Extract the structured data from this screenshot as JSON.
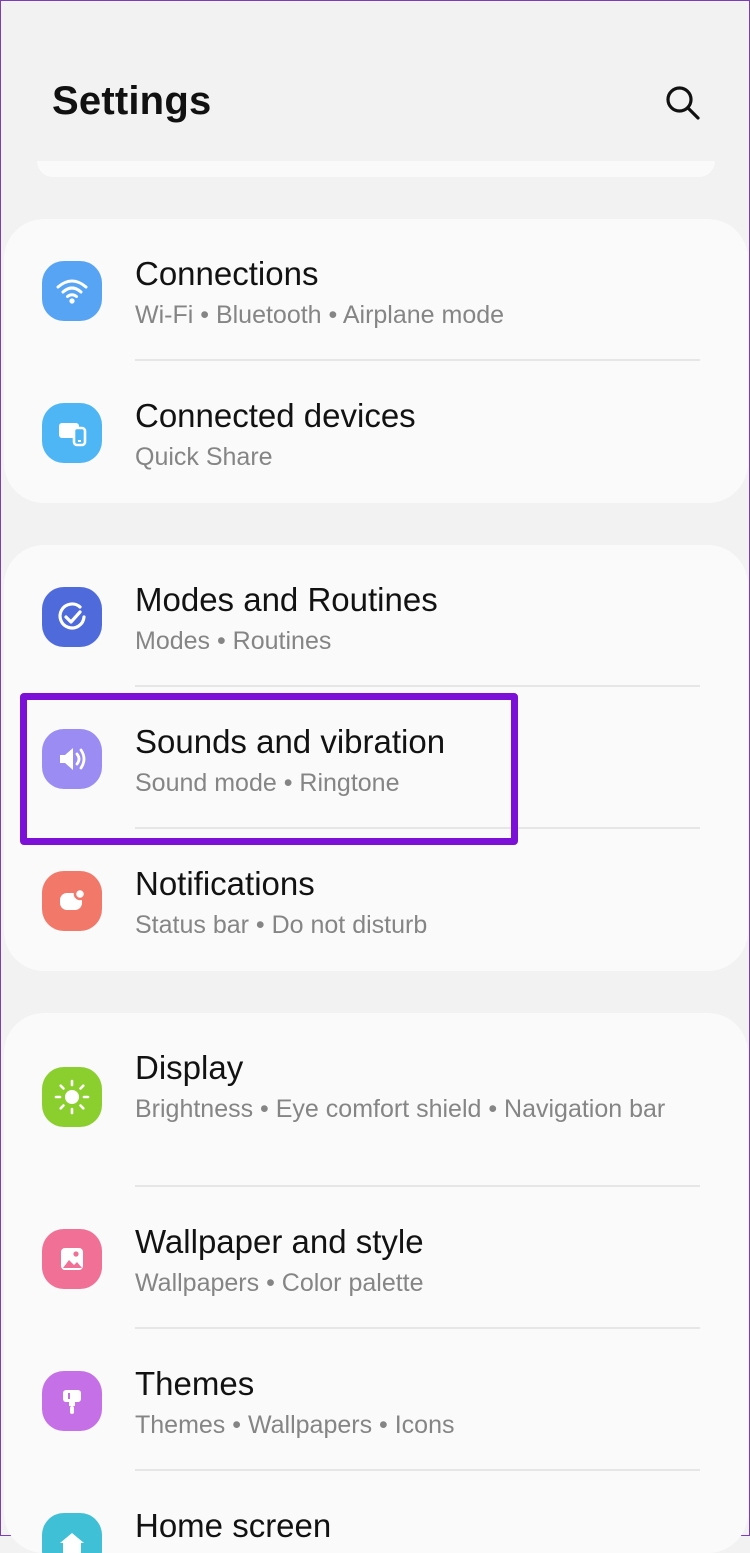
{
  "header": {
    "title": "Settings",
    "search_icon": "search-icon"
  },
  "groups": [
    {
      "items": [
        {
          "title": "Connections",
          "subtitle": "Wi-Fi  •  Bluetooth  •  Airplane mode",
          "icon": "wifi-icon",
          "color": "#57a4f5"
        },
        {
          "title": "Connected devices",
          "subtitle": "Quick Share",
          "icon": "devices-icon",
          "color": "#4fb6f5"
        }
      ]
    },
    {
      "items": [
        {
          "title": "Modes and Routines",
          "subtitle": "Modes  •  Routines",
          "icon": "check-circle-icon",
          "color": "#4f6bdb"
        },
        {
          "title": "Sounds and vibration",
          "subtitle": "Sound mode  •  Ringtone",
          "icon": "speaker-icon",
          "color": "#9a8cf2"
        },
        {
          "title": "Notifications",
          "subtitle": "Status bar  •  Do not disturb",
          "icon": "notification-icon",
          "color": "#f2786a"
        }
      ]
    },
    {
      "items": [
        {
          "title": "Display",
          "subtitle": "Brightness  •  Eye comfort shield  •  Navigation bar",
          "icon": "sun-icon",
          "color": "#8bcf2f"
        },
        {
          "title": "Wallpaper and style",
          "subtitle": "Wallpapers  •  Color palette",
          "icon": "image-icon",
          "color": "#f07096"
        },
        {
          "title": "Themes",
          "subtitle": "Themes  •  Wallpapers  •  Icons",
          "icon": "brush-icon",
          "color": "#c570e6"
        },
        {
          "title": "Home screen",
          "subtitle": "",
          "icon": "home-icon",
          "color": "#3fc0d6"
        }
      ]
    }
  ],
  "highlight_color": "#7d10d6"
}
